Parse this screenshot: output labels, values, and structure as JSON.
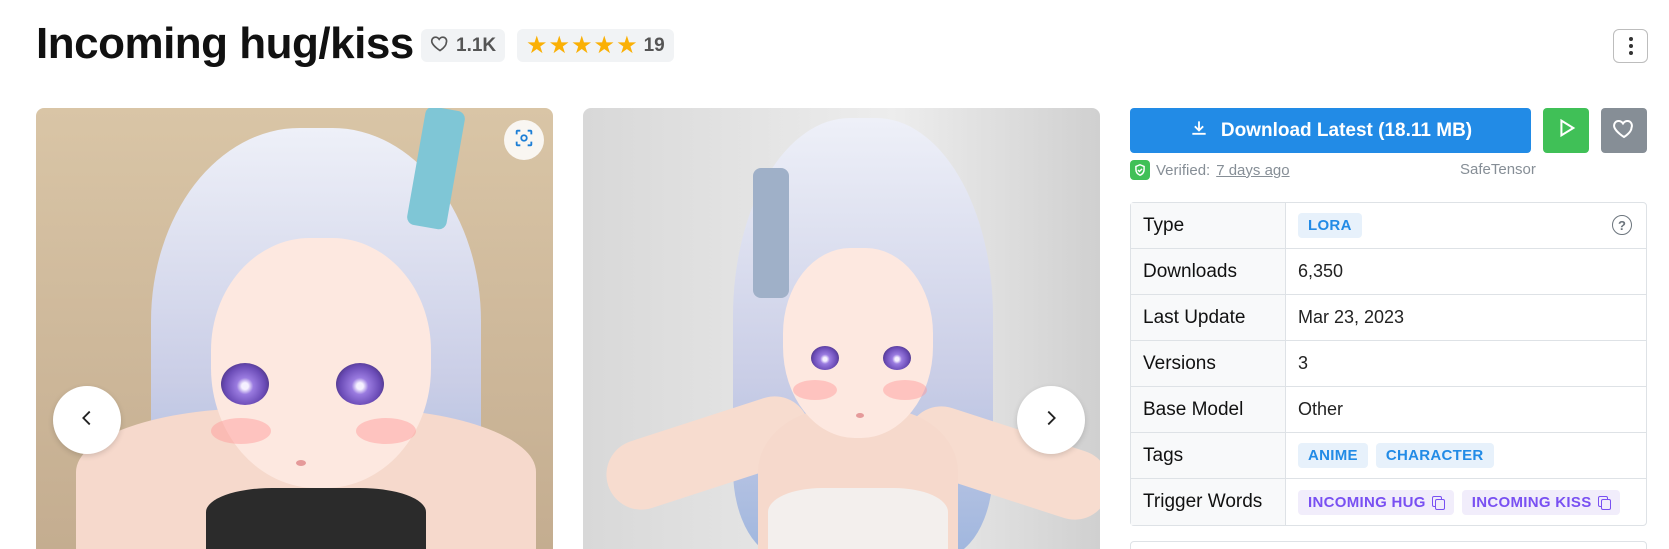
{
  "header": {
    "title": "Incoming hug/kiss",
    "likes": "1.1K",
    "rating_count": "19",
    "rating_stars": 5
  },
  "gallery": {
    "images": [
      {
        "alt": "anime girl reaching toward viewer, close up"
      },
      {
        "alt": "anime girl in white dress with outstretched arms"
      }
    ]
  },
  "actions": {
    "download_label": "Download Latest (18.11 MB)",
    "verified_label": "Verified:",
    "verified_ago": "7 days ago",
    "format": "SafeTensor"
  },
  "details": {
    "rows": [
      {
        "key": "Type",
        "badges": [
          "LORA"
        ]
      },
      {
        "key": "Downloads",
        "value": "6,350"
      },
      {
        "key": "Last Update",
        "value": "Mar 23, 2023"
      },
      {
        "key": "Versions",
        "value": "3"
      },
      {
        "key": "Base Model",
        "value": "Other"
      },
      {
        "key": "Tags",
        "badges": [
          "ANIME",
          "CHARACTER"
        ]
      },
      {
        "key": "Trigger Words",
        "badges": [
          "INCOMING HUG",
          "INCOMING KISS"
        ]
      }
    ]
  },
  "colors": {
    "primary": "#228be6",
    "success": "#40c057",
    "neutral": "#868e96",
    "violet": "#7950f2",
    "star": "#fab005"
  }
}
